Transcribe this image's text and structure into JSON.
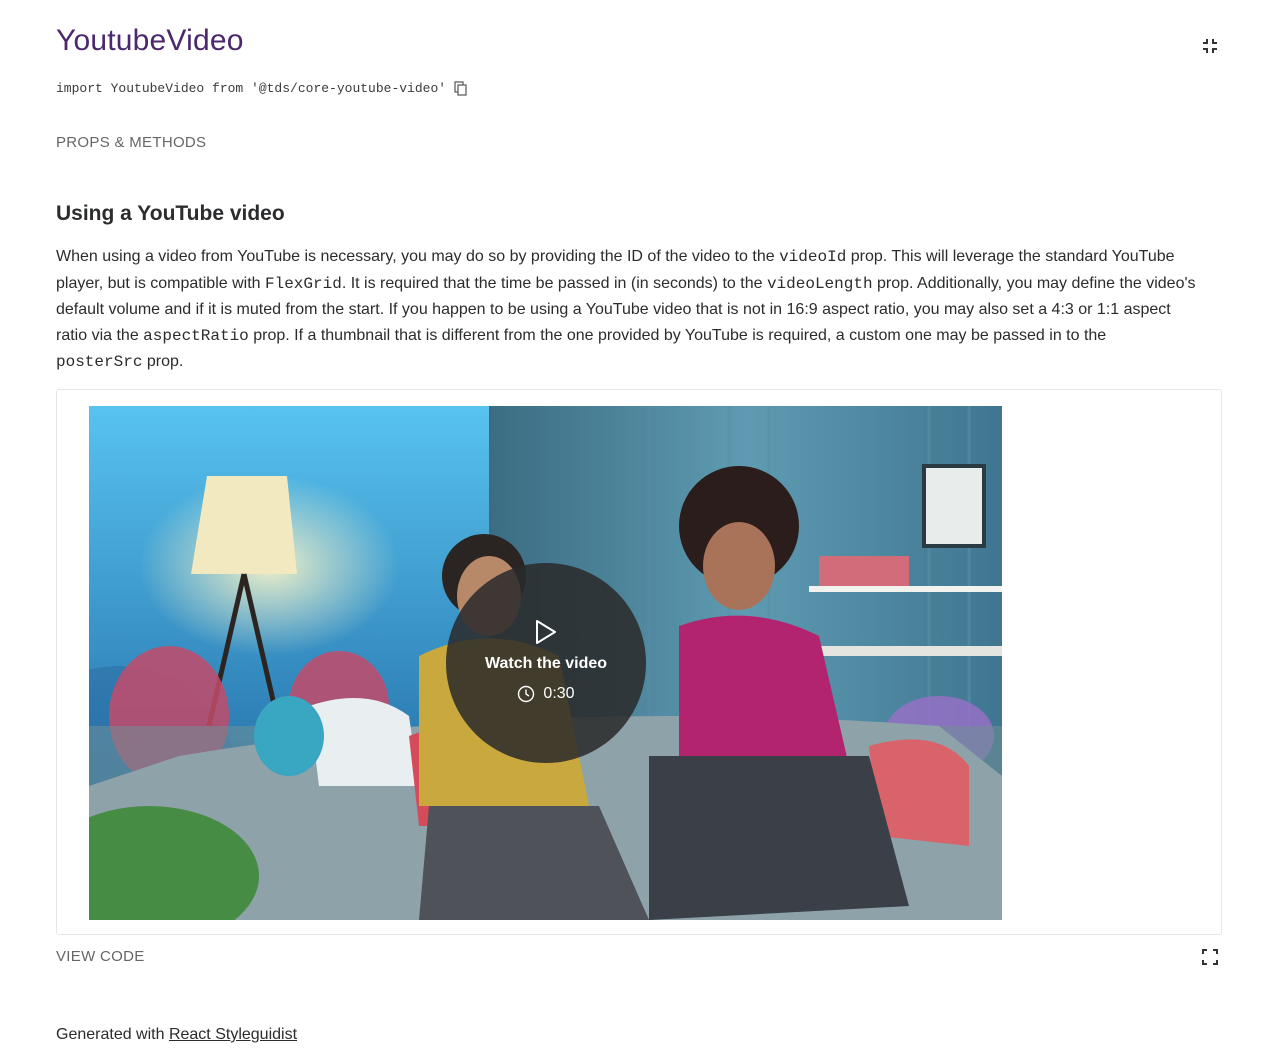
{
  "page": {
    "title": "YoutubeVideo",
    "import_statement": "import YoutubeVideo from '@tds/core-youtube-video'",
    "props_methods_label": "PROPS & METHODS"
  },
  "section": {
    "heading": "Using a YouTube video",
    "desc_1": "When using a video from YouTube is necessary, you may do so by providing the ID of the video to the ",
    "code_1": "videoId",
    "desc_2": " prop. This will leverage the standard YouTube player, but is compatible with ",
    "code_2": "FlexGrid",
    "desc_3": ". It is required that the time be passed in (in seconds) to the ",
    "code_3": "videoLength",
    "desc_4": " prop. Additionally, you may define the video's default volume and if it is muted from the start. If you happen to be using a YouTube video that is not in 16:9 aspect ratio, you may also set a 4:3 or 1:1 aspect ratio via the ",
    "code_4": "aspectRatio",
    "desc_5": " prop. If a thumbnail that is different from the one provided by YouTube is required, a custom one may be passed in to the ",
    "code_5": "posterSrc",
    "desc_6": " prop."
  },
  "video": {
    "watch_label": "Watch the video",
    "duration": "0:30"
  },
  "preview_controls": {
    "view_code_label": "VIEW CODE"
  },
  "footer": {
    "prefix": "Generated with ",
    "link_label": "React Styleguidist"
  },
  "colors": {
    "brand_purple": "#4b286d",
    "text": "#2a2c2e",
    "muted": "#666666"
  },
  "icons": {
    "collapse": "collapse-icon",
    "copy": "copy-icon",
    "play": "play-icon",
    "clock": "clock-icon",
    "fullscreen": "fullscreen-icon"
  }
}
